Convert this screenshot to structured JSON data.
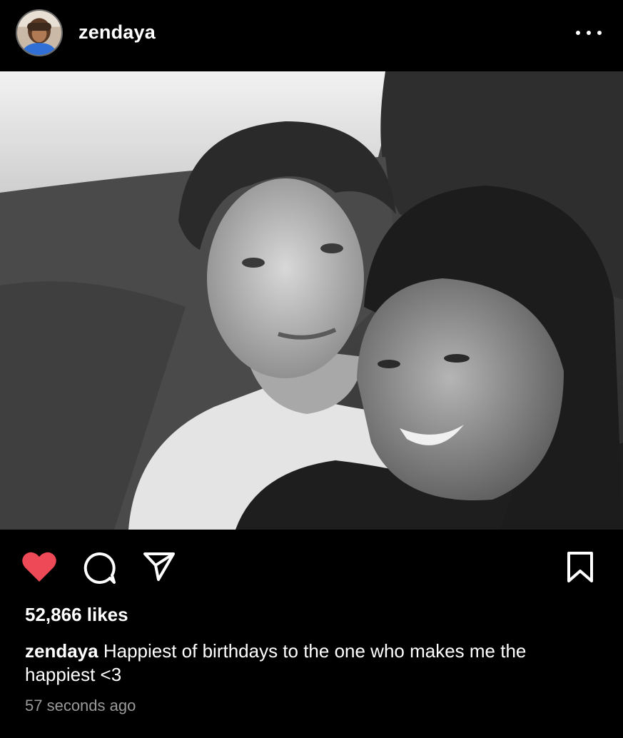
{
  "header": {
    "username": "zendaya",
    "more_icon": "more-horizontal-icon"
  },
  "post": {
    "image_description_icon": "post-photo"
  },
  "actions": {
    "like_icon": "heart-icon",
    "like_color": "#ed4956",
    "comment_icon": "comment-icon",
    "share_icon": "send-icon",
    "save_icon": "bookmark-icon"
  },
  "likes": {
    "text": "52,866 likes"
  },
  "caption": {
    "username": "zendaya",
    "text": " Happiest of birthdays to the one who makes me the happiest <3"
  },
  "timestamp": {
    "text": "57 seconds ago"
  }
}
